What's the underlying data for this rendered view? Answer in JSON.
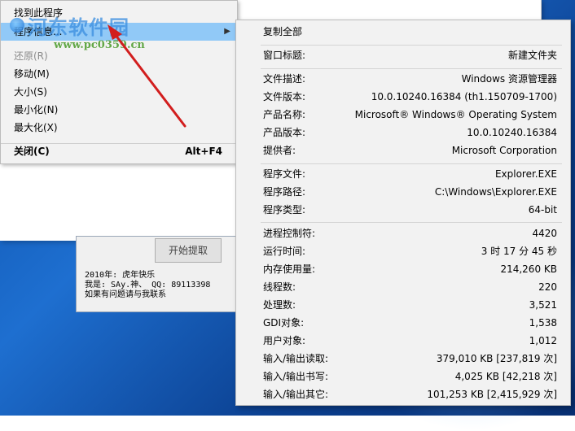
{
  "context_menu": {
    "items": [
      {
        "label": "找到此程序",
        "accel": ""
      },
      {
        "label": "程序信息...",
        "accel": ""
      },
      {
        "label": "还原(R)",
        "accel": ""
      },
      {
        "label": "移动(M)",
        "accel": ""
      },
      {
        "label": "大小(S)",
        "accel": ""
      },
      {
        "label": "最小化(N)",
        "accel": ""
      },
      {
        "label": "最大化(X)",
        "accel": ""
      },
      {
        "label": "关闭(C)",
        "accel": "Alt+F4"
      }
    ]
  },
  "submenu": {
    "copy_all": "复制全部",
    "window_title": {
      "key": "窗口标题:",
      "value": "新建文件夹"
    },
    "file_info": [
      {
        "key": "文件描述:",
        "value": "Windows 资源管理器"
      },
      {
        "key": "文件版本:",
        "value": "10.0.10240.16384 (th1.150709-1700)"
      },
      {
        "key": "产品名称:",
        "value": "Microsoft® Windows® Operating System"
      },
      {
        "key": "产品版本:",
        "value": "10.0.10240.16384"
      },
      {
        "key": "提供者:",
        "value": "Microsoft Corporation"
      }
    ],
    "program": [
      {
        "key": "程序文件:",
        "value": "Explorer.EXE"
      },
      {
        "key": "程序路径:",
        "value": "C:\\Windows\\Explorer.EXE"
      },
      {
        "key": "程序类型:",
        "value": "64-bit"
      }
    ],
    "process": [
      {
        "key": "进程控制符:",
        "value": "4420"
      },
      {
        "key": "运行时间:",
        "value": "3 时 17 分 45 秒"
      },
      {
        "key": "内存使用量:",
        "value": "214,260 KB"
      },
      {
        "key": "线程数:",
        "value": "220"
      },
      {
        "key": "处理数:",
        "value": "3,521"
      },
      {
        "key": "GDI对象:",
        "value": "1,538"
      },
      {
        "key": "用户对象:",
        "value": "1,012"
      },
      {
        "key": "输入/输出读取:",
        "value": "379,010 KB   [237,819 次]"
      },
      {
        "key": "输入/输出书写:",
        "value": "4,025 KB   [42,218 次]"
      },
      {
        "key": "输入/输出其它:",
        "value": "101,253 KB   [2,415,929 次]"
      }
    ]
  },
  "tool_dialog": {
    "start_button": "开始提取",
    "line1": "2010年: 虎年快乐",
    "line2": "我是: SAy.神、 QQ: 89113398",
    "line3": "如果有问题请与我联系"
  },
  "watermark": {
    "title": "河东软件园",
    "url": "www.pc0359.cn"
  },
  "colors": {
    "highlight": "#91c9f7",
    "arrow": "#d21e1e",
    "desktop": "#1e6fd0"
  }
}
